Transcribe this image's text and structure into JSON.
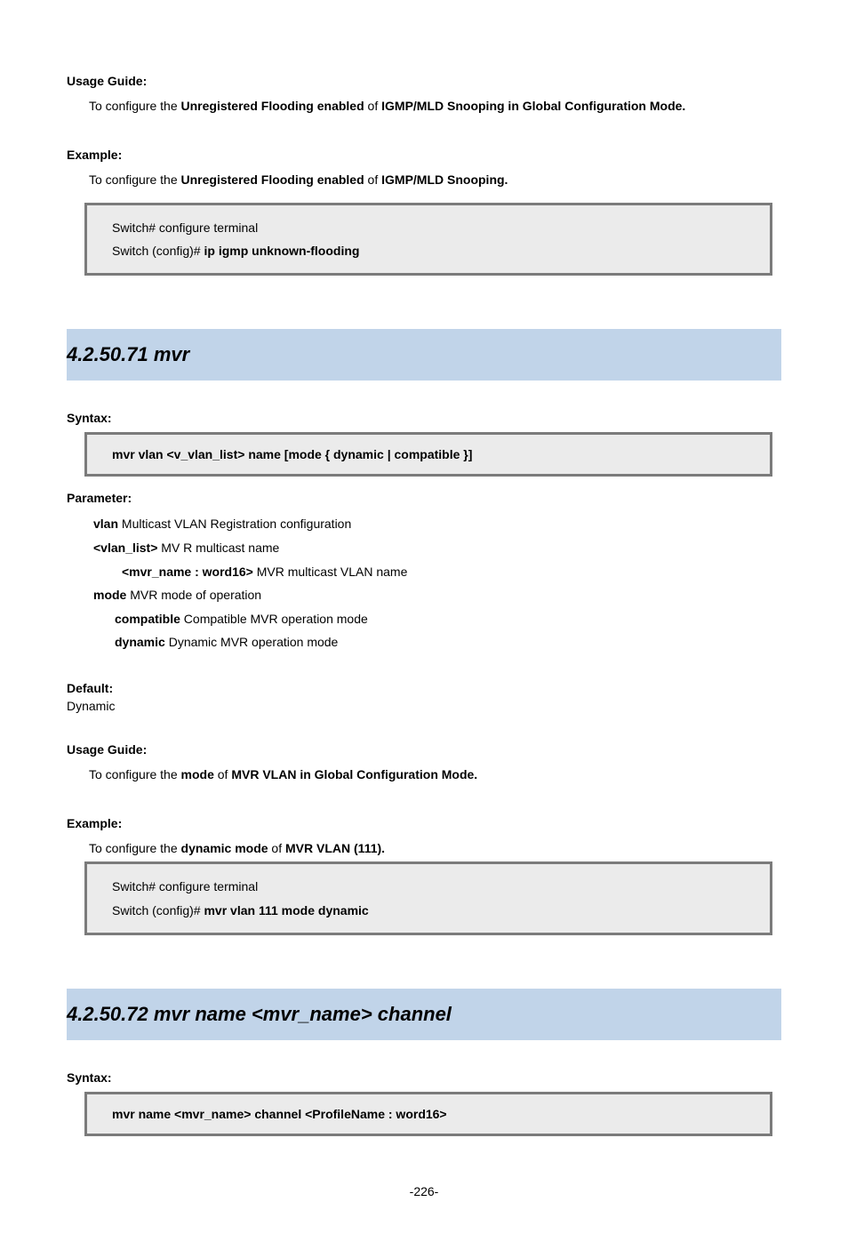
{
  "intro": {
    "usage_label": "Usage Guide:",
    "usage_line_pre": "To configure the ",
    "usage_bold_1": "Unregistered Flooding enabled ",
    "usage_mid": "of",
    "usage_bold_2": " IGMP/MLD Snooping in Global Configuration Mode.",
    "example_label": "Example:",
    "example_line_pre": "To configure the ",
    "example_bold_1": "Unregistered Flooding enabled",
    "example_mid": " of ",
    "example_bold_2": "IGMP/MLD Snooping.",
    "code1": "Switch# configure terminal",
    "code2": "Switch (config)# ",
    "code2_bold": "ip igmp unknown-flooding"
  },
  "sec1": {
    "title": "4.2.50.71 mvr",
    "syntax_label": "Syntax:",
    "syntax_text": "mvr vlan <v_vlan_list> name [mode { dynamic | compatible }]",
    "param_label": "Parameter:",
    "params": [
      {
        "key": "vlan",
        "desc": " Multicast VLAN Registration configuration",
        "indent": 0
      },
      {
        "key": "<vlan_list>",
        "desc": " MV R multicast name",
        "indent": 0
      },
      {
        "key": "<mvr_name : word16>",
        "desc": " MVR multicast VLAN name",
        "indent": 1
      },
      {
        "key": "mode",
        "desc": " MVR mode of operation",
        "indent": 0
      },
      {
        "key": "compatible",
        "desc": " Compatible MVR operation mode",
        "indent": 2
      },
      {
        "key": "dynamic",
        "desc": " Dynamic MVR operation mode",
        "indent": 2
      }
    ],
    "default_label": "Default:",
    "default_val": "Dynamic",
    "usage_label": "Usage Guide:",
    "usage_pre": "To configure the ",
    "usage_b1": "mode ",
    "usage_mid": "of",
    "usage_b2": " MVR VLAN in Global Configuration Mode.",
    "example_label": "Example:",
    "example_pre": "To configure the ",
    "example_b1": "dynamic mode",
    "example_mid": " of ",
    "example_b2": "MVR VLAN (111).",
    "code1": "Switch# configure terminal",
    "code2": "Switch (config)# ",
    "code2_bold": "mvr vlan 111 mode dynamic"
  },
  "sec2": {
    "title": "4.2.50.72 mvr name <mvr_name> channel",
    "syntax_label": "Syntax:",
    "syntax_text": "mvr name <mvr_name> channel <ProfileName : word16>"
  },
  "page_number": "-226-"
}
